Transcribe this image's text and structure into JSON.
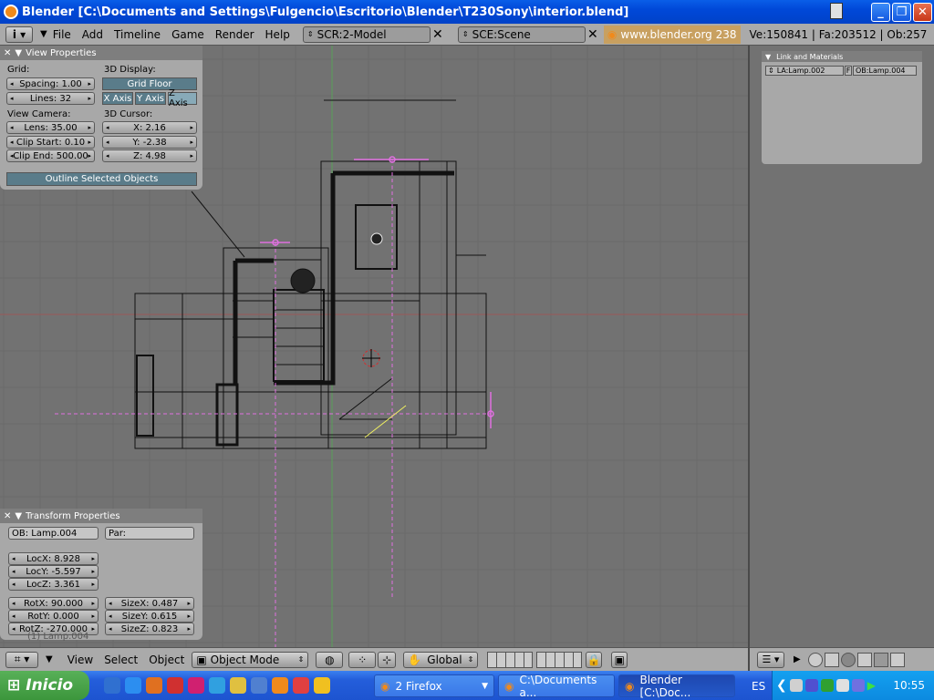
{
  "window": {
    "title": "Blender [C:\\Documents and Settings\\Fulgencio\\Escritorio\\Blender\\T230Sony\\interior.blend]",
    "minimize": "_",
    "maximize": "❐",
    "close": "✕"
  },
  "main_header": {
    "menus": [
      "File",
      "Add",
      "Timeline",
      "Game",
      "Render",
      "Help"
    ],
    "screen_field": "SCR:2-Model",
    "scene_field": "SCE:Scene",
    "url": "www.blender.org 238",
    "stats": "Ve:150841 | Fa:203512 | Ob:257"
  },
  "view_properties": {
    "title": "View Properties",
    "grid_label": "Grid:",
    "spacing": "Spacing: 1.00",
    "lines": "Lines: 32",
    "display_label": "3D Display:",
    "grid_floor": "Grid Floor",
    "x_axis": "X Axis",
    "y_axis": "Y Axis",
    "z_axis": "Z Axis",
    "view_camera_label": "View Camera:",
    "lens": "Lens: 35.00",
    "clip_start": "Clip Start: 0.10",
    "clip_end": "Clip End: 500.00",
    "cursor_label": "3D Cursor:",
    "cursor_x": "X: 2.16",
    "cursor_y": "Y: -2.38",
    "cursor_z": "Z: 4.98",
    "outline": "Outline Selected Objects"
  },
  "transform_properties": {
    "title": "Transform Properties",
    "ob": "OB: Lamp.004",
    "par": "Par:",
    "locx": "LocX: 8.928",
    "locy": "LocY: -5.597",
    "locz": "LocZ: 3.361",
    "rotx": "RotX: 90.000",
    "roty": "RotY: 0.000",
    "rotz": "RotZ: -270.000",
    "sizex": "SizeX: 0.487",
    "sizey": "SizeY: 0.615",
    "sizez": "SizeZ: 0.823",
    "overlay": "(1) Lamp.004"
  },
  "link_materials": {
    "title": "Link and Materials",
    "la": "LA:Lamp.002",
    "f": "F",
    "ob": "OB:Lamp.004"
  },
  "bottom_header": {
    "view": "View",
    "select": "Select",
    "object": "Object",
    "mode": "Object Mode",
    "orientation": "Global"
  },
  "taskbar": {
    "start": "Inicio",
    "tasks": [
      "2 Firefox",
      "C:\\Documents a...",
      "Blender [C:\\Doc..."
    ],
    "lang": "ES",
    "clock": "10:55"
  },
  "colors": {
    "title_blue": "#0a5ee8",
    "viewport_bg": "#727272",
    "grid_line": "#6a6a6a",
    "axis_red": "#a05050",
    "axis_green": "#50a050",
    "lamp_pink": "#e070e0",
    "selected_yellow": "#f0f060"
  }
}
